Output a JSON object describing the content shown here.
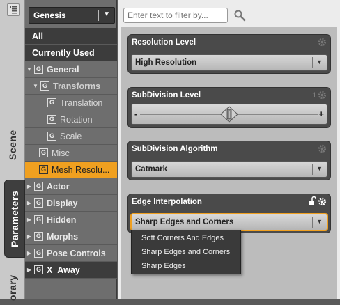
{
  "tabs": {
    "scene": "Scene",
    "parameters": "Parameters",
    "library": "orary"
  },
  "tree": {
    "figure": "Genesis",
    "all": "All",
    "currently_used": "Currently Used",
    "general": "General",
    "transforms": "Transforms",
    "translation": "Translation",
    "rotation": "Rotation",
    "scale": "Scale",
    "misc": "Misc",
    "mesh_resolution": "Mesh Resolu...",
    "actor": "Actor",
    "display": "Display",
    "hidden": "Hidden",
    "morphs": "Morphs",
    "pose_controls": "Pose Controls",
    "x_away": "X_Away",
    "group_glyph": "G"
  },
  "filter": {
    "placeholder": "Enter text to filter by..."
  },
  "params": {
    "resolution_level": {
      "title": "Resolution Level",
      "value": "High Resolution"
    },
    "subdivision_level": {
      "title": "SubDivision Level",
      "value": "1",
      "minus": "-",
      "plus": "+",
      "level": 1
    },
    "subdivision_algorithm": {
      "title": "SubDivision Algorithm",
      "value": "Catmark"
    },
    "edge_interpolation": {
      "title": "Edge Interpolation",
      "value": "Sharp Edges and Corners"
    }
  },
  "dropdown": {
    "options": [
      "Soft Corners And Edges",
      "Sharp Edges and Corners",
      "Sharp Edges"
    ]
  },
  "colors": {
    "selected": "#f0a020",
    "panel_dark": "#3c3c3c"
  }
}
